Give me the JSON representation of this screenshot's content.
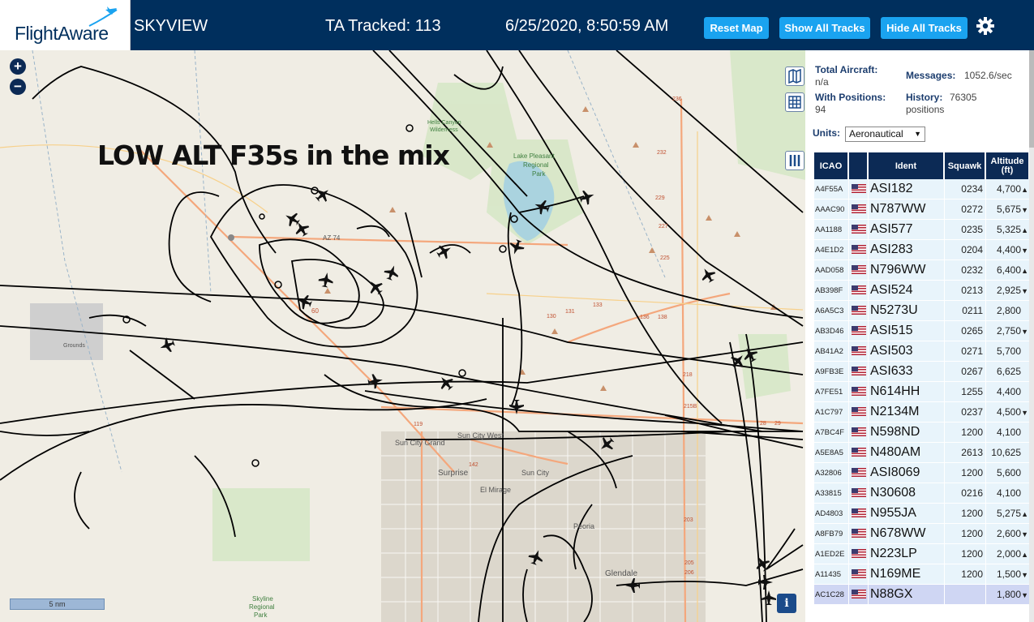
{
  "header": {
    "logo_text": "FlightAware",
    "site_title": "SKYVIEW",
    "tracked": "TA Tracked: 113",
    "datetime": "6/25/2020, 8:50:59 AM",
    "buttons": {
      "reset_map": "Reset Map",
      "show_all_tracks": "Show All Tracks",
      "hide_all_tracks": "Hide All Tracks"
    }
  },
  "map": {
    "annotation": "LOW ALT F35s in the mix",
    "zoom_in": "+",
    "zoom_out": "−",
    "scale_label": "5 nm",
    "info_label": "i",
    "place_labels": [
      "Sun City Grand",
      "Sun City West",
      "Surprise",
      "Sun City",
      "El Mirage",
      "Peoria",
      "Glendale",
      "Skyline Regional Park",
      "Lake Pleasant Regional Park",
      "Hells Canyon Wilderness",
      "Grounds"
    ],
    "road_labels": [
      "AZ 74",
      "60",
      "119",
      "142",
      "136",
      "138",
      "130",
      "131",
      "133",
      "218",
      "215B",
      "203",
      "205",
      "206",
      "225",
      "227",
      "229",
      "232",
      "236",
      "28",
      "29"
    ],
    "colors": {
      "land": "#f0ede4",
      "water": "#aad3df",
      "track": "#000000",
      "road_major": "#f4a77c",
      "road_minor": "#ffffff",
      "park": "#c7e3b4"
    }
  },
  "panel": {
    "total_aircraft_label": "Total Aircraft:",
    "total_aircraft_value": "n/a",
    "messages_label": "Messages:",
    "messages_value": "1052.6/sec",
    "with_positions_label": "With Positions:",
    "with_positions_value": "94",
    "history_label": "History:",
    "history_value_1": "76305",
    "history_value_2": "positions",
    "units_label": "Units:",
    "units_value": "Aeronautical",
    "columns": [
      "ICAO",
      "",
      "Ident",
      "Squawk",
      "Altitude (ft)"
    ],
    "rows": [
      {
        "icao": "A4F55A",
        "ident": "ASI182",
        "squawk": "0234",
        "altitude": "4,700",
        "trend": "▲"
      },
      {
        "icao": "AAAC90",
        "ident": "N787WW",
        "squawk": "0272",
        "altitude": "5,675",
        "trend": "▼"
      },
      {
        "icao": "AA1188",
        "ident": "ASI577",
        "squawk": "0235",
        "altitude": "5,325",
        "trend": "▲"
      },
      {
        "icao": "A4E1D2",
        "ident": "ASI283",
        "squawk": "0204",
        "altitude": "4,400",
        "trend": "▼"
      },
      {
        "icao": "AAD058",
        "ident": "N796WW",
        "squawk": "0232",
        "altitude": "6,400",
        "trend": "▲"
      },
      {
        "icao": "AB398F",
        "ident": "ASI524",
        "squawk": "0213",
        "altitude": "2,925",
        "trend": "▼"
      },
      {
        "icao": "A6A5C3",
        "ident": "N5273U",
        "squawk": "0211",
        "altitude": "2,800",
        "trend": ""
      },
      {
        "icao": "AB3D46",
        "ident": "ASI515",
        "squawk": "0265",
        "altitude": "2,750",
        "trend": "▼"
      },
      {
        "icao": "AB41A2",
        "ident": "ASI503",
        "squawk": "0271",
        "altitude": "5,700",
        "trend": ""
      },
      {
        "icao": "A9FB3E",
        "ident": "ASI633",
        "squawk": "0267",
        "altitude": "6,625",
        "trend": ""
      },
      {
        "icao": "A7FE51",
        "ident": "N614HH",
        "squawk": "1255",
        "altitude": "4,400",
        "trend": ""
      },
      {
        "icao": "A1C797",
        "ident": "N2134M",
        "squawk": "0237",
        "altitude": "4,500",
        "trend": "▼"
      },
      {
        "icao": "A7BC4F",
        "ident": "N598ND",
        "squawk": "1200",
        "altitude": "4,100",
        "trend": ""
      },
      {
        "icao": "A5E8A5",
        "ident": "N480AM",
        "squawk": "2613",
        "altitude": "10,625",
        "trend": ""
      },
      {
        "icao": "A32806",
        "ident": "ASI8069",
        "squawk": "1200",
        "altitude": "5,600",
        "trend": ""
      },
      {
        "icao": "A33815",
        "ident": "N30608",
        "squawk": "0216",
        "altitude": "4,100",
        "trend": ""
      },
      {
        "icao": "AD4803",
        "ident": "N955JA",
        "squawk": "1200",
        "altitude": "5,275",
        "trend": "▲"
      },
      {
        "icao": "A8FB79",
        "ident": "N678WW",
        "squawk": "1200",
        "altitude": "2,600",
        "trend": "▼"
      },
      {
        "icao": "A1ED2E",
        "ident": "N223LP",
        "squawk": "1200",
        "altitude": "2,000",
        "trend": "▲"
      },
      {
        "icao": "A11435",
        "ident": "N169ME",
        "squawk": "1200",
        "altitude": "1,500",
        "trend": "▼"
      },
      {
        "icao": "AC1C28",
        "ident": "N88GX",
        "squawk": "",
        "altitude": "1,800",
        "trend": "▼",
        "selected": true
      }
    ]
  }
}
